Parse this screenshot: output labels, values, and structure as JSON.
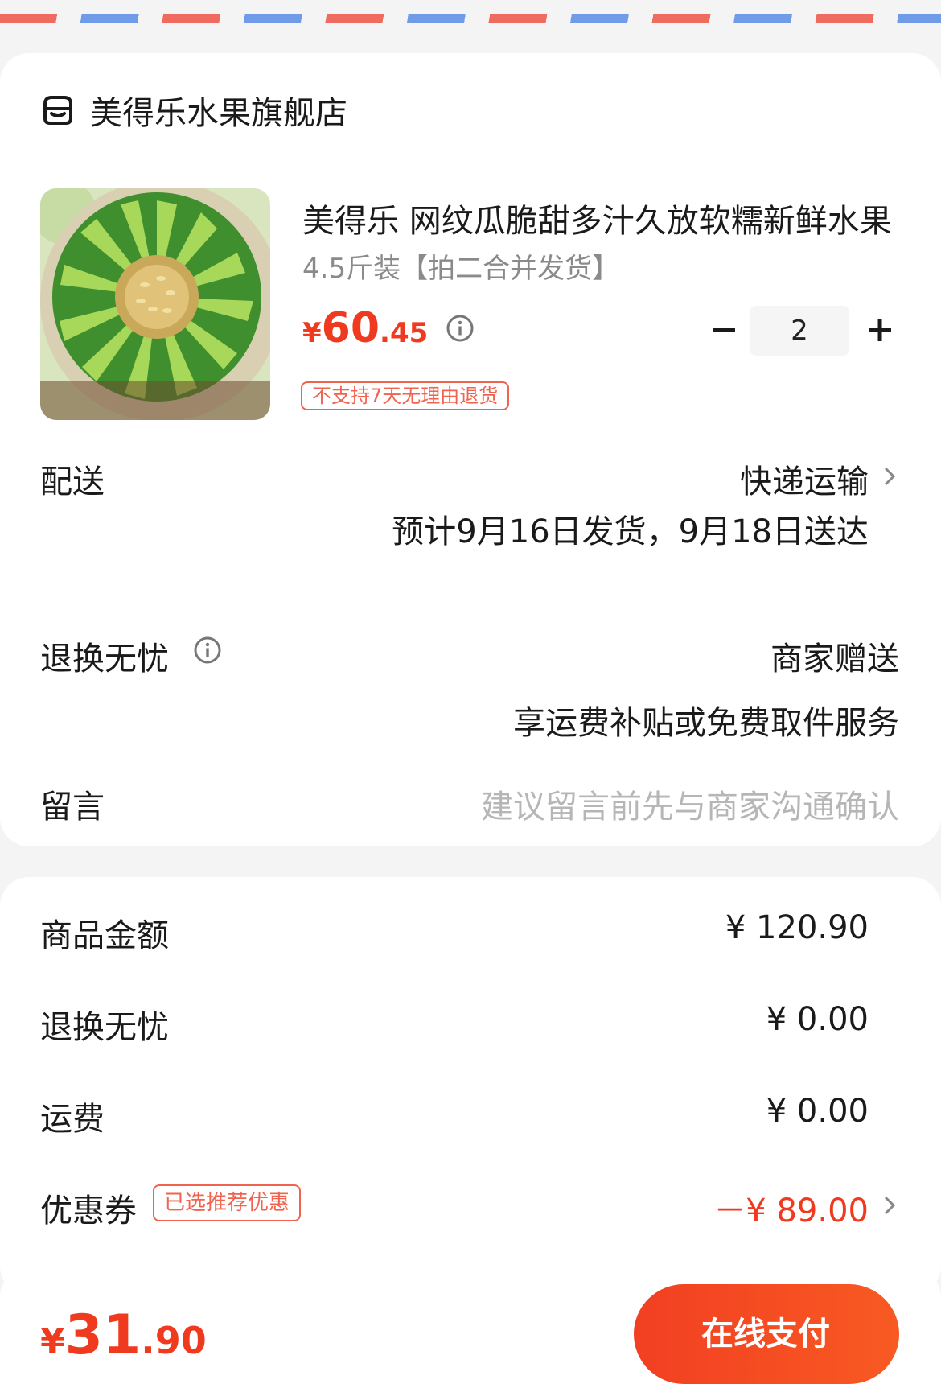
{
  "shop": {
    "name": "美得乐水果旗舰店",
    "icon": "shop-icon"
  },
  "product": {
    "title": "美得乐 网纹瓜脆甜多汁久放软糯新鲜水果",
    "spec": "4.5斤装【拍二合并发货】",
    "price": {
      "symbol": "¥",
      "integer": "60",
      "decimal": ".45"
    },
    "quantity": "2",
    "return_tag": "不支持7天无理由退货",
    "image": "cantaloupe-melon-photo"
  },
  "delivery": {
    "label": "配送",
    "method": "快递运输",
    "estimate": "预计9月16日发货，9月18日送达"
  },
  "refund_care": {
    "label": "退换无忧",
    "value": "商家赠送",
    "note": "享运费补贴或免费取件服务"
  },
  "message": {
    "label": "留言",
    "placeholder": "建议留言前先与商家沟通确认"
  },
  "summary": {
    "goods_amount": {
      "label": "商品金额",
      "value": "¥ 120.90"
    },
    "refund_care": {
      "label": "退换无忧",
      "value": "¥ 0.00"
    },
    "shipping": {
      "label": "运费",
      "value": "¥ 0.00"
    },
    "coupon": {
      "label": "优惠券",
      "tag": "已选推荐优惠",
      "value": "－¥ 89.00"
    }
  },
  "footer": {
    "total": {
      "symbol": "¥",
      "integer": "31",
      "decimal": ".90"
    },
    "pay_label": "在线支付"
  },
  "colors": {
    "accent": "#f03a1f",
    "airmail_red": "#f06b5f",
    "airmail_blue": "#6f9be8"
  }
}
